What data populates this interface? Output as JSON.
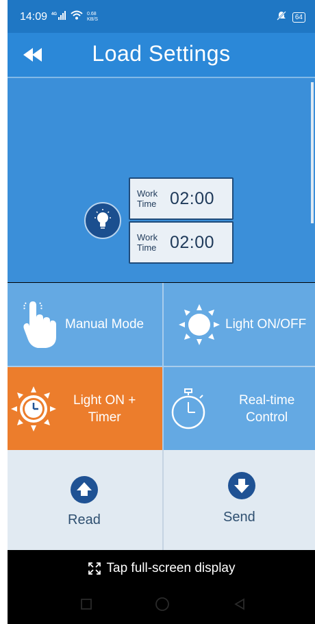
{
  "status_bar": {
    "time": "14:09",
    "signal": "4G",
    "network_speed": "0.68",
    "speed_unit": "KB/S",
    "battery": "64"
  },
  "header": {
    "title": "Load Settings"
  },
  "display": {
    "rows": [
      {
        "label_line1": "Work",
        "label_line2": "Time",
        "value": "02:00"
      },
      {
        "label_line1": "Work",
        "label_line2": "Time",
        "value": "02:00"
      }
    ]
  },
  "modes": {
    "manual": "Manual Mode",
    "light_onoff": "Light ON/OFF",
    "light_timer_line1": "Light ON +",
    "light_timer_line2": "Timer",
    "realtime_line1": "Real-time",
    "realtime_line2": "Control",
    "active_color": "#ec7d2c",
    "button_color": "#64a9e3"
  },
  "actions": {
    "read": "Read",
    "send": "Send"
  },
  "footer": {
    "fullscreen_hint": "Tap full-screen display"
  },
  "colors": {
    "primary": "#2b88d8",
    "panel": "#3b8fd9",
    "dark_blue": "#1f5294"
  }
}
